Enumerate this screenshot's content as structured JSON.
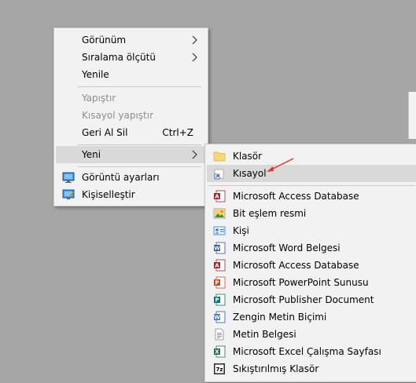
{
  "context_menu": {
    "items": [
      {
        "label": "Görünüm"
      },
      {
        "label": "Sıralama ölçütü"
      },
      {
        "label": "Yenile"
      },
      {
        "label": "Yapıştır"
      },
      {
        "label": "Kısayol yapıştır"
      },
      {
        "label": "Geri Al Sil",
        "shortcut": "Ctrl+Z"
      },
      {
        "label": "Yeni"
      },
      {
        "label": "Görüntü ayarları",
        "icon": "display-settings-icon"
      },
      {
        "label": "Kişiselleştir",
        "icon": "personalize-icon"
      }
    ]
  },
  "new_submenu": {
    "items": [
      {
        "label": "Klasör",
        "icon": "folder-icon"
      },
      {
        "label": "Kısayol",
        "icon": "shortcut-icon"
      },
      {
        "label": "Microsoft Access Database",
        "icon": "access-icon"
      },
      {
        "label": "Bit eşlem resmi",
        "icon": "bitmap-icon"
      },
      {
        "label": "Kişi",
        "icon": "contact-icon"
      },
      {
        "label": "Microsoft Word Belgesi",
        "icon": "word-icon"
      },
      {
        "label": "Microsoft Access Database",
        "icon": "access-icon"
      },
      {
        "label": "Microsoft PowerPoint Sunusu",
        "icon": "powerpoint-icon"
      },
      {
        "label": "Microsoft Publisher Document",
        "icon": "publisher-icon"
      },
      {
        "label": "Zengin Metin Biçimi",
        "icon": "rtf-icon"
      },
      {
        "label": "Metin Belgesi",
        "icon": "text-document-icon"
      },
      {
        "label": "Microsoft Excel Çalışma Sayfası",
        "icon": "excel-icon"
      },
      {
        "label": "Sıkıştırılmış Klasör",
        "icon": "zip-folder-icon"
      }
    ]
  },
  "colors": {
    "menu_bg": "#f2f2f2",
    "highlight": "#d9d9d9",
    "desktop": "#a6a6a6",
    "annotation": "#e8312d"
  }
}
